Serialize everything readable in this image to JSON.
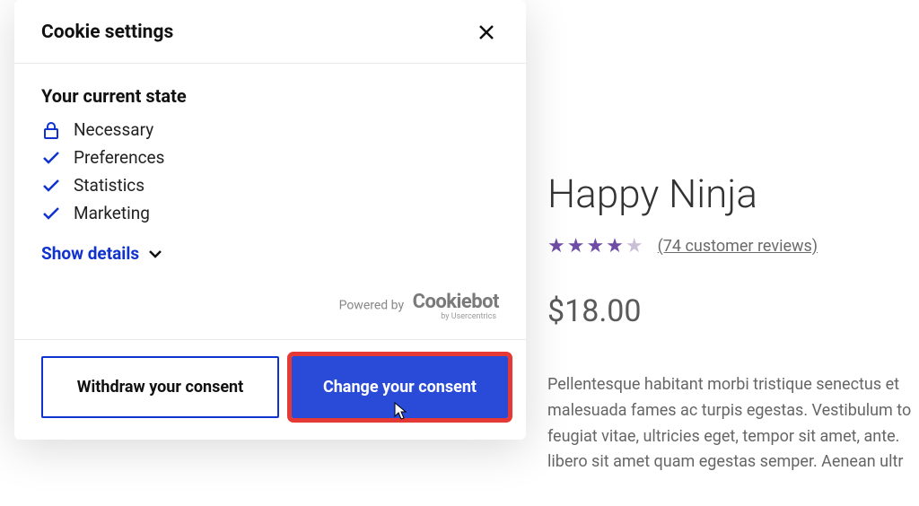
{
  "dialog": {
    "title": "Cookie settings",
    "state_title": "Your current state",
    "categories": [
      {
        "icon": "lock",
        "label": "Necessary"
      },
      {
        "icon": "check",
        "label": "Preferences"
      },
      {
        "icon": "check",
        "label": "Statistics"
      },
      {
        "icon": "check",
        "label": "Marketing"
      }
    ],
    "show_details": "Show details",
    "powered_by_prefix": "Powered by",
    "powered_by_brand": "Cookiebot",
    "powered_by_sub": "by Usercentrics",
    "withdraw_label": "Withdraw your consent",
    "change_label": "Change your consent"
  },
  "product": {
    "title": "Happy Ninja",
    "rating": 4,
    "rating_max": 5,
    "reviews_text": "(74 customer reviews)",
    "price": "$18.00",
    "description": "Pellentesque habitant morbi tristique senectus et malesuada fames ac turpis egestas. Vestibulum to feugiat vitae, ultricies eget, tempor sit amet, ante. libero sit amet quam egestas semper. Aenean ultr"
  },
  "colors": {
    "accent": "#1032cf",
    "primary_btn": "#2a4bd7",
    "highlight": "#e53935",
    "star": "#6f4ca5"
  }
}
